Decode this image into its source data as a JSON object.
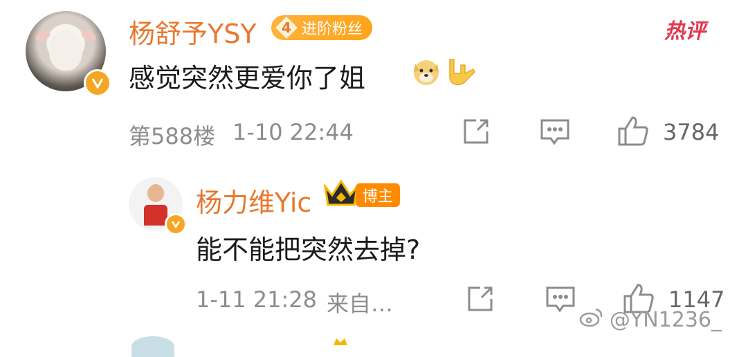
{
  "hot_tag": "热评",
  "main_comment": {
    "user": "杨舒予YSY",
    "fan_level": "4",
    "fan_badge_label": "进阶粉丝",
    "text": "感觉突然更爱你了姐",
    "emoji": [
      "doge-emoji",
      "rock-hand-emoji"
    ],
    "floor": "第588楼",
    "time": "1-10 22:44",
    "likes": "3784"
  },
  "reply": {
    "user": "杨力维Yic",
    "owner_badge": "博主",
    "text": "能不能把突然去掉?",
    "time": "1-11 21:28",
    "source": "来自…",
    "likes": "1147"
  },
  "watermark": "@YN1236_",
  "colors": {
    "name": "#e8782d",
    "meta": "#8c8c8c",
    "badge": "#ffa31a",
    "hot": "#e0384e"
  }
}
